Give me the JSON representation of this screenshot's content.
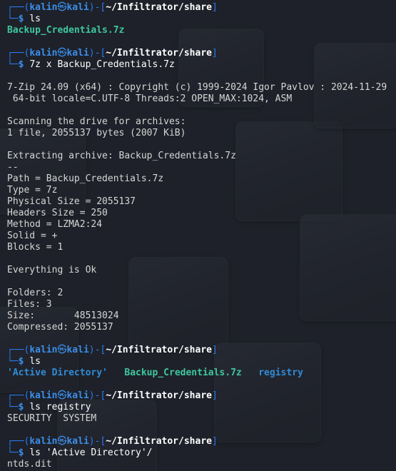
{
  "theme": {
    "background": "#1e2129",
    "prompt_color": "#2a79f0",
    "path_color": "#ffffff",
    "archive_file_color": "#3ec7a2",
    "directory_color": "#2f8bd8",
    "output_color": "#d6d6d6"
  },
  "prompt": {
    "open": "┌──(",
    "user": "kalin",
    "at_icon": "㉿",
    "host": "kali",
    "mid": ")-[",
    "path": "~/Infiltrator/share",
    "close": "]",
    "corner": "└─",
    "dollar": "$"
  },
  "blocks": [
    {
      "command": "ls",
      "output": [
        {
          "type": "files",
          "items": [
            {
              "text": "Backup_Credentials.7z",
              "kind": "archive"
            }
          ]
        }
      ]
    },
    {
      "command": "7z x Backup_Credentials.7z",
      "output": [
        {
          "type": "text",
          "text": ""
        },
        {
          "type": "text",
          "text": "7-Zip 24.09 (x64) : Copyright (c) 1999-2024 Igor Pavlov : 2024-11-29"
        },
        {
          "type": "text",
          "text": " 64-bit locale=C.UTF-8 Threads:2 OPEN_MAX:1024, ASM"
        },
        {
          "type": "text",
          "text": ""
        },
        {
          "type": "text",
          "text": "Scanning the drive for archives:"
        },
        {
          "type": "text",
          "text": "1 file, 2055137 bytes (2007 KiB)"
        },
        {
          "type": "text",
          "text": ""
        },
        {
          "type": "text",
          "text": "Extracting archive: Backup_Credentials.7z"
        },
        {
          "type": "text",
          "text": "--"
        },
        {
          "type": "text",
          "text": "Path = Backup_Credentials.7z"
        },
        {
          "type": "text",
          "text": "Type = 7z"
        },
        {
          "type": "text",
          "text": "Physical Size = 2055137"
        },
        {
          "type": "text",
          "text": "Headers Size = 250"
        },
        {
          "type": "text",
          "text": "Method = LZMA2:24"
        },
        {
          "type": "text",
          "text": "Solid = +"
        },
        {
          "type": "text",
          "text": "Blocks = 1"
        },
        {
          "type": "text",
          "text": ""
        },
        {
          "type": "text",
          "text": "Everything is Ok"
        },
        {
          "type": "text",
          "text": ""
        },
        {
          "type": "text",
          "text": "Folders: 2"
        },
        {
          "type": "text",
          "text": "Files: 3"
        },
        {
          "type": "text",
          "text": "Size:       48513024"
        },
        {
          "type": "text",
          "text": "Compressed: 2055137"
        }
      ]
    },
    {
      "command": "ls",
      "output": [
        {
          "type": "files",
          "items": [
            {
              "text": "'Active Directory'",
              "kind": "dir"
            },
            {
              "text": "   ",
              "kind": "plain"
            },
            {
              "text": "Backup_Credentials.7z",
              "kind": "archive"
            },
            {
              "text": "   ",
              "kind": "plain"
            },
            {
              "text": "registry",
              "kind": "dir"
            }
          ]
        }
      ]
    },
    {
      "command": "ls registry",
      "output": [
        {
          "type": "text",
          "text": "SECURITY  SYSTEM"
        }
      ]
    },
    {
      "command": "ls 'Active Directory'/",
      "output": [
        {
          "type": "text",
          "text": "ntds.dit"
        }
      ]
    }
  ]
}
